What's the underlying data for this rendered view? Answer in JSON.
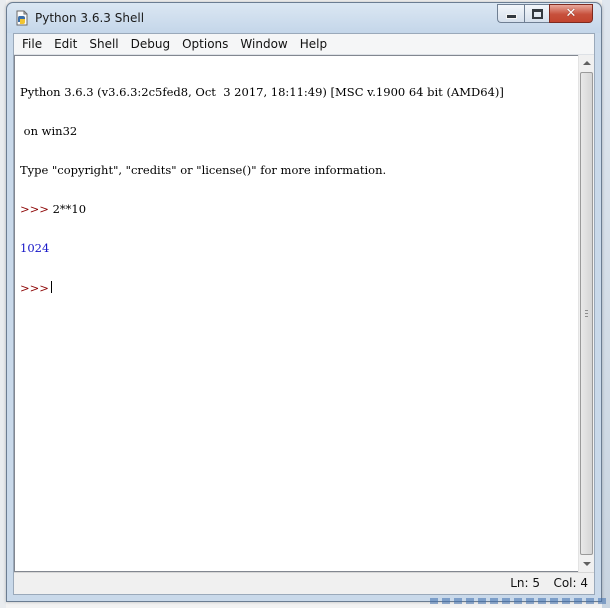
{
  "window": {
    "title": "Python 3.6.3 Shell"
  },
  "menubar": {
    "items": [
      "File",
      "Edit",
      "Shell",
      "Debug",
      "Options",
      "Window",
      "Help"
    ]
  },
  "shell": {
    "banner_line1": "Python 3.6.3 (v3.6.3:2c5fed8, Oct  3 2017, 18:11:49) [MSC v.1900 64 bit (AMD64)]",
    "banner_line2": " on win32",
    "banner_line3": "Type \"copyright\", \"credits\" or \"license()\" for more information.",
    "prompt": ">>>",
    "command": " 2**10",
    "result": "1024"
  },
  "status": {
    "line": "Ln: 5",
    "column": "Col: 4"
  },
  "colors": {
    "prompt": "#8b0000",
    "output": "#1616c8"
  }
}
